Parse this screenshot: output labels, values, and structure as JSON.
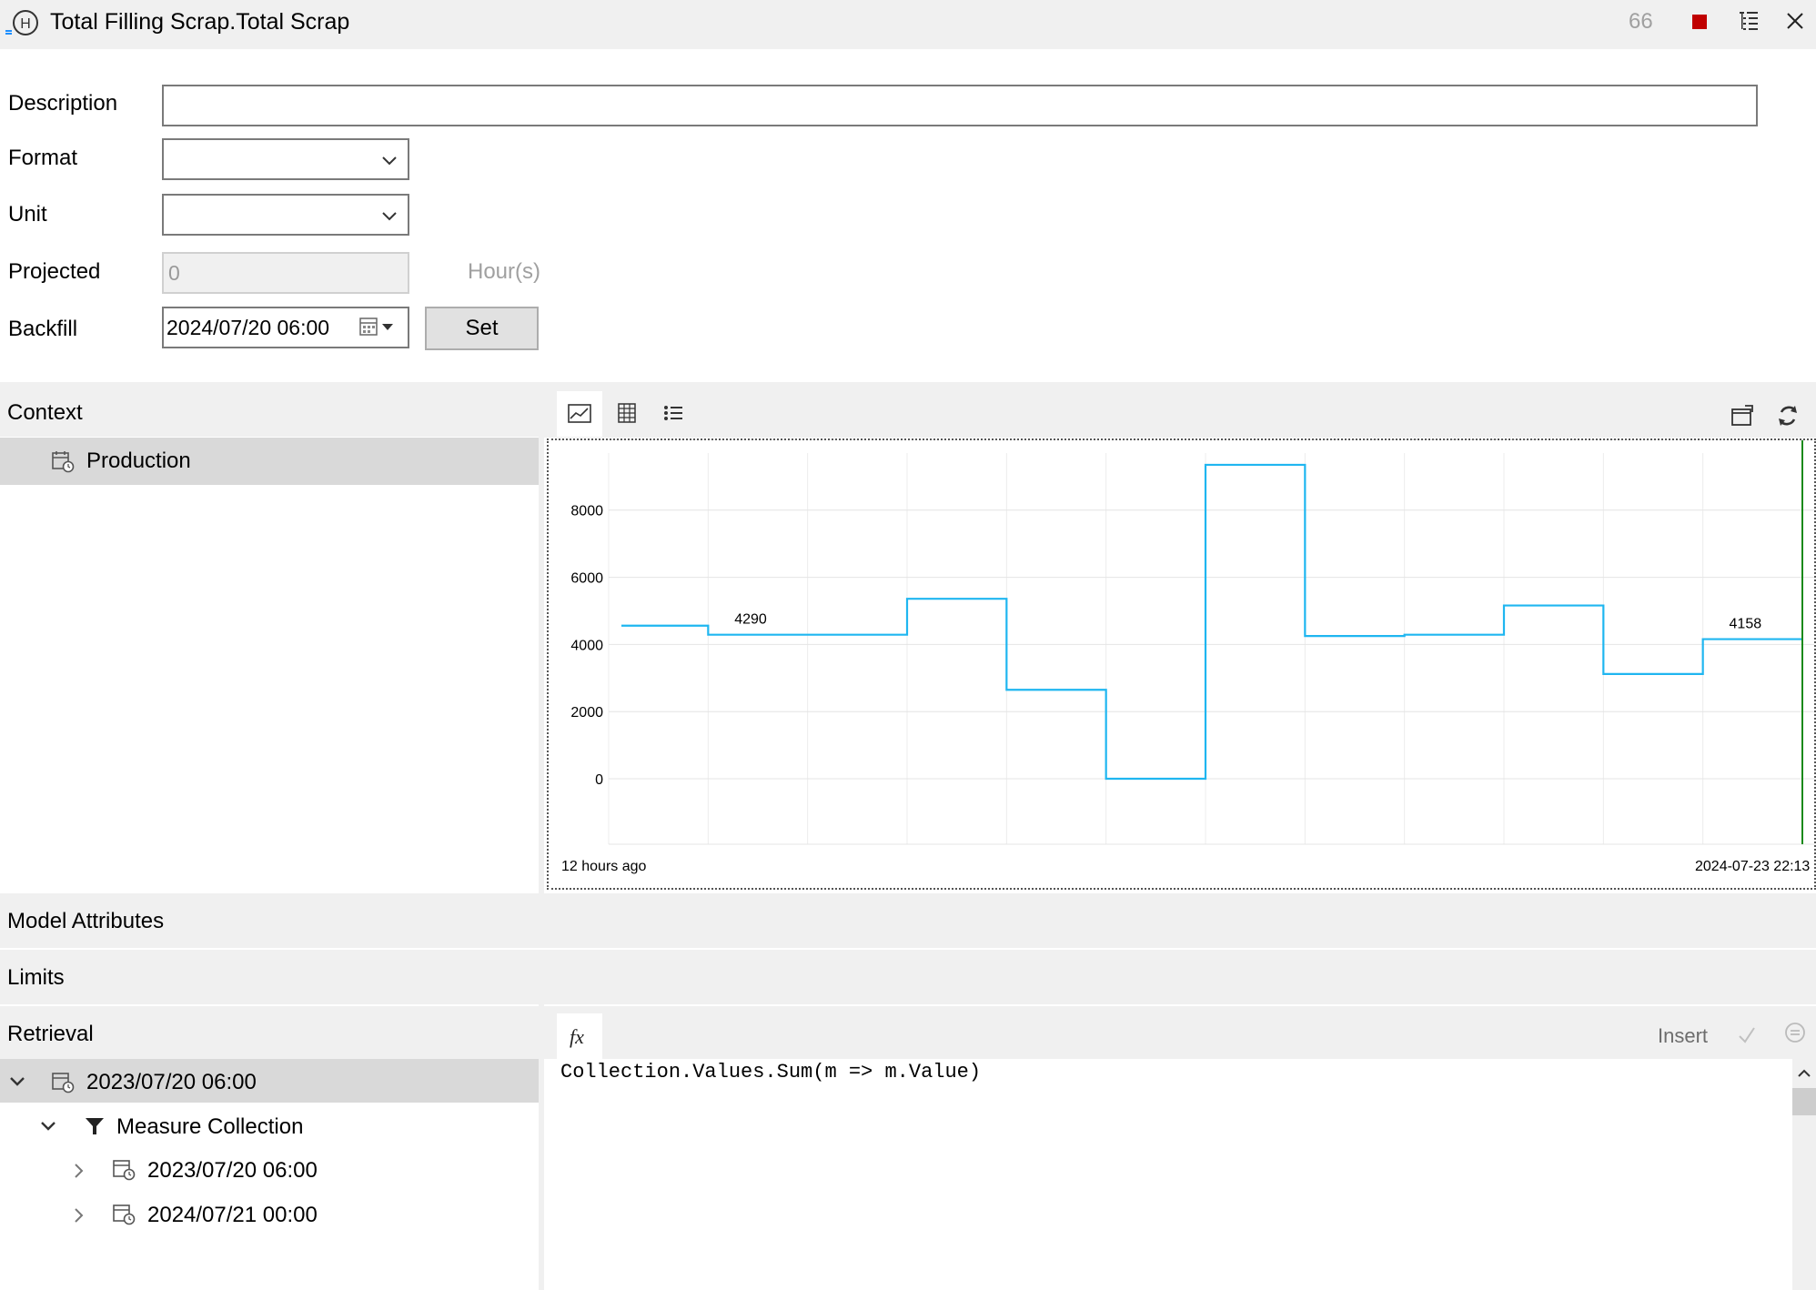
{
  "window": {
    "title": "Total Filling Scrap.Total Scrap",
    "count": "66"
  },
  "form": {
    "description_label": "Description",
    "description_value": "",
    "format_label": "Format",
    "format_value": "",
    "unit_label": "Unit",
    "unit_value": "",
    "projected_label": "Projected",
    "projected_value": "0",
    "projected_unit": "Hour(s)",
    "backfill_label": "Backfill",
    "backfill_value": "2024/07/20 06:00",
    "set_label": "Set"
  },
  "context": {
    "title": "Context",
    "items": [
      {
        "label": "Production"
      }
    ]
  },
  "sections": {
    "model_attributes": "Model Attributes",
    "limits": "Limits",
    "retrieval": "Retrieval"
  },
  "retrieval": {
    "tree": [
      {
        "label": "2023/07/20 06:00",
        "expanded": true,
        "icon": "calendar-clock-icon"
      },
      {
        "label": "Measure Collection",
        "expanded": true,
        "icon": "filter-icon"
      },
      {
        "label": "2023/07/20 06:00",
        "expanded": false,
        "icon": "calendar-clock-icon"
      },
      {
        "label": "2024/07/21 00:00",
        "expanded": false,
        "icon": "calendar-clock-icon"
      }
    ],
    "insert_label": "Insert",
    "expression": "Collection.Values.Sum(m => m.Value)"
  },
  "chart_data": {
    "type": "line",
    "step": true,
    "color": "#1fb6f0",
    "cursor_color": "#1a8a1a",
    "x_start_label": "12 hours ago",
    "x_end_label": "2024-07-23 22:13",
    "yticks": [
      0,
      2000,
      4000,
      6000,
      8000
    ],
    "ylim": [
      -1950,
      9700
    ],
    "grid": true,
    "segments": 12,
    "values": [
      4560,
      4290,
      4290,
      5360,
      2650,
      0,
      9350,
      4250,
      4290,
      5160,
      3120,
      4158
    ],
    "annotations": [
      {
        "index": 1,
        "text": "4290"
      },
      {
        "index": 11,
        "text": "4158"
      }
    ]
  }
}
